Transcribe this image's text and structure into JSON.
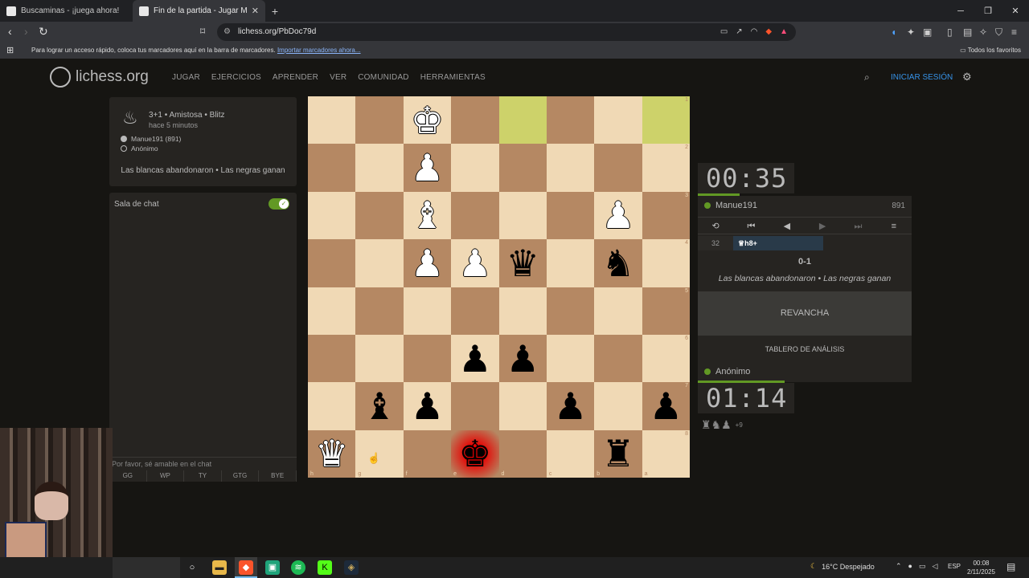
{
  "browser": {
    "tabs": [
      {
        "label": "Buscaminas - ¡juega ahora!",
        "active": false
      },
      {
        "label": "Fin de la partida - Jugar Manue191",
        "active": true
      }
    ],
    "url": "lichess.org/PbDoc79d",
    "bookmarks_message": "Para lograr un acceso rápido, coloca tus marcadores aquí en la barra de marcadores.",
    "bookmarks_link": "Importar marcadores ahora...",
    "all_favorites": "Todos los favoritos"
  },
  "site": {
    "logo": "lichess.org",
    "menu": [
      "JUGAR",
      "EJERCICIOS",
      "APRENDER",
      "VER",
      "COMUNIDAD",
      "HERRAMIENTAS"
    ],
    "login": "INICIAR SESIÓN"
  },
  "game_info": {
    "type": "3+1 • Amistosa • Blitz",
    "time_ago": "hace 5 minutos",
    "white": "Manue191 (891)",
    "black": "Anónimo",
    "result": "Las blancas abandonaron • Las negras ganan"
  },
  "chat": {
    "title": "Sala de chat",
    "placeholder": "Por favor, sé amable en el chat",
    "quick": [
      "GG",
      "WP",
      "TY",
      "GTG",
      "BYE"
    ]
  },
  "board": {
    "orientation": "black",
    "ranks": [
      "1",
      "2",
      "3",
      "4",
      "5",
      "6",
      "7",
      "8"
    ],
    "files": [
      "h",
      "g",
      "f",
      "e",
      "d",
      "c",
      "b",
      "a"
    ],
    "rows": [
      [
        "",
        "",
        "♚w",
        "",
        "",
        "",
        "",
        ""
      ],
      [
        "",
        "",
        "♟w",
        "",
        "",
        "",
        "",
        ""
      ],
      [
        "",
        "",
        "♝w",
        "",
        "",
        "",
        "♟w",
        ""
      ],
      [
        "",
        "",
        "♟w",
        "♟w",
        "♛b",
        "",
        "♞b",
        ""
      ],
      [
        "",
        "",
        "",
        "",
        "",
        "",
        "",
        ""
      ],
      [
        "",
        "",
        "",
        "♟b",
        "♟b",
        "",
        "",
        ""
      ],
      [
        "",
        "♝b",
        "♟b",
        "",
        "",
        "♟b",
        "",
        "♟b"
      ],
      [
        "♛w",
        "",
        "",
        "♚b",
        "",
        "",
        "♜b",
        ""
      ]
    ],
    "highlights": [
      "0-4",
      "0-7"
    ],
    "check": "7-3"
  },
  "right": {
    "top_clock": "00:35",
    "top_player": "Manue191",
    "top_rating": "891",
    "move_number": "32",
    "move_san": "♕h8+",
    "score": "0-1",
    "result": "Las blancas abandonaron • Las negras ganan",
    "rematch": "REVANCHA",
    "analysis": "TABLERO DE ANÁLISIS",
    "bottom_player": "Anónimo",
    "bottom_clock": "01:14",
    "material_pieces": "♜♞♟",
    "material_plus": "+9"
  },
  "taskbar": {
    "weather": "16°C Despejado",
    "lang": "ESP",
    "time": "00:08",
    "date": "2/11/2025"
  }
}
